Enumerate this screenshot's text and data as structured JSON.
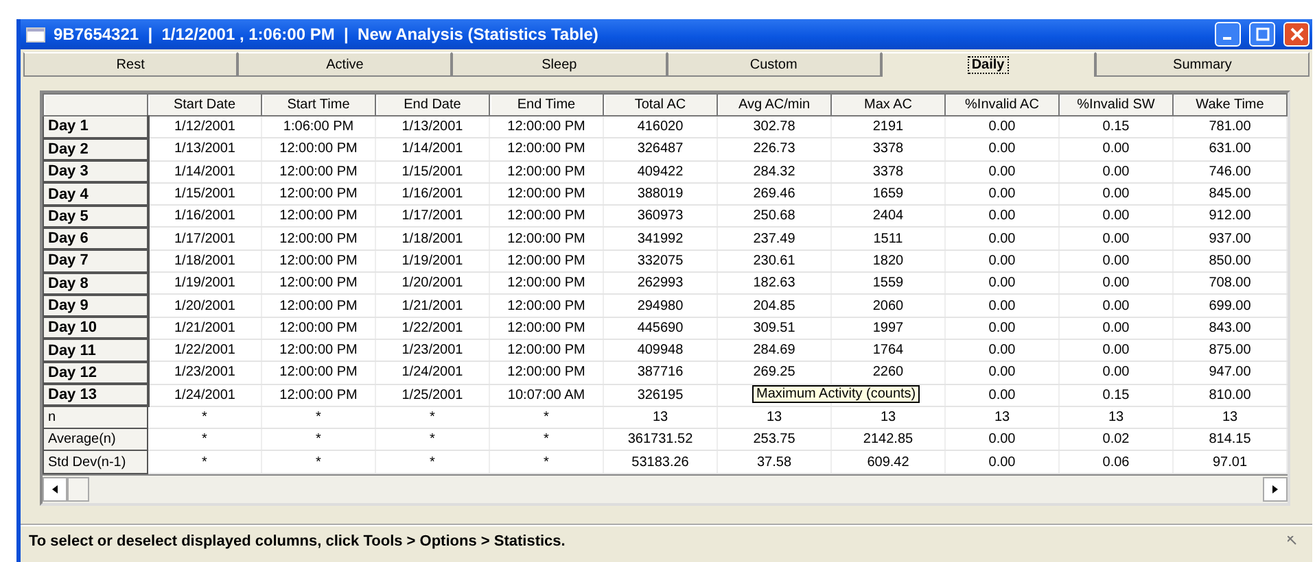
{
  "window": {
    "title": "9B7654321  |  1/12/2001 , 1:06:00 PM  |  New Analysis (Statistics Table)"
  },
  "tabs": [
    {
      "label": "Rest",
      "selected": false
    },
    {
      "label": "Active",
      "selected": false
    },
    {
      "label": "Sleep",
      "selected": false
    },
    {
      "label": "Custom",
      "selected": false
    },
    {
      "label": "Daily",
      "selected": true
    },
    {
      "label": "Summary",
      "selected": false
    }
  ],
  "table": {
    "columns": [
      "Start Date",
      "Start Time",
      "End Date",
      "End Time",
      "Total AC",
      "Avg AC/min",
      "Max AC",
      "%Invalid AC",
      "%Invalid SW",
      "Wake Time"
    ],
    "rows": [
      {
        "kind": "day",
        "label": "Day 1",
        "cells": [
          "1/12/2001",
          "1:06:00 PM",
          "1/13/2001",
          "12:00:00 PM",
          "416020",
          "302.78",
          "2191",
          "0.00",
          "0.15",
          "781.00"
        ]
      },
      {
        "kind": "day",
        "label": "Day 2",
        "cells": [
          "1/13/2001",
          "12:00:00 PM",
          "1/14/2001",
          "12:00:00 PM",
          "326487",
          "226.73",
          "3378",
          "0.00",
          "0.00",
          "631.00"
        ]
      },
      {
        "kind": "day",
        "label": "Day 3",
        "cells": [
          "1/14/2001",
          "12:00:00 PM",
          "1/15/2001",
          "12:00:00 PM",
          "409422",
          "284.32",
          "3378",
          "0.00",
          "0.00",
          "746.00"
        ]
      },
      {
        "kind": "day",
        "label": "Day 4",
        "cells": [
          "1/15/2001",
          "12:00:00 PM",
          "1/16/2001",
          "12:00:00 PM",
          "388019",
          "269.46",
          "1659",
          "0.00",
          "0.00",
          "845.00"
        ]
      },
      {
        "kind": "day",
        "label": "Day 5",
        "cells": [
          "1/16/2001",
          "12:00:00 PM",
          "1/17/2001",
          "12:00:00 PM",
          "360973",
          "250.68",
          "2404",
          "0.00",
          "0.00",
          "912.00"
        ]
      },
      {
        "kind": "day",
        "label": "Day 6",
        "cells": [
          "1/17/2001",
          "12:00:00 PM",
          "1/18/2001",
          "12:00:00 PM",
          "341992",
          "237.49",
          "1511",
          "0.00",
          "0.00",
          "937.00"
        ]
      },
      {
        "kind": "day",
        "label": "Day 7",
        "cells": [
          "1/18/2001",
          "12:00:00 PM",
          "1/19/2001",
          "12:00:00 PM",
          "332075",
          "230.61",
          "1820",
          "0.00",
          "0.00",
          "850.00"
        ]
      },
      {
        "kind": "day",
        "label": "Day 8",
        "cells": [
          "1/19/2001",
          "12:00:00 PM",
          "1/20/2001",
          "12:00:00 PM",
          "262993",
          "182.63",
          "1559",
          "0.00",
          "0.00",
          "708.00"
        ]
      },
      {
        "kind": "day",
        "label": "Day 9",
        "cells": [
          "1/20/2001",
          "12:00:00 PM",
          "1/21/2001",
          "12:00:00 PM",
          "294980",
          "204.85",
          "2060",
          "0.00",
          "0.00",
          "699.00"
        ]
      },
      {
        "kind": "day",
        "label": "Day 10",
        "cells": [
          "1/21/2001",
          "12:00:00 PM",
          "1/22/2001",
          "12:00:00 PM",
          "445690",
          "309.51",
          "1997",
          "0.00",
          "0.00",
          "843.00"
        ]
      },
      {
        "kind": "day",
        "label": "Day 11",
        "cells": [
          "1/22/2001",
          "12:00:00 PM",
          "1/23/2001",
          "12:00:00 PM",
          "409948",
          "284.69",
          "1764",
          "0.00",
          "0.00",
          "875.00"
        ]
      },
      {
        "kind": "day",
        "label": "Day 12",
        "cells": [
          "1/23/2001",
          "12:00:00 PM",
          "1/24/2001",
          "12:00:00 PM",
          "387716",
          "269.25",
          "2260",
          "0.00",
          "0.00",
          "947.00"
        ]
      },
      {
        "kind": "day",
        "label": "Day 13",
        "cells": [
          "1/24/2001",
          "12:00:00 PM",
          "1/25/2001",
          "10:07:00 AM",
          "326195",
          null,
          null,
          "0.00",
          "0.15",
          "810.00"
        ]
      },
      {
        "kind": "summary",
        "label": "n",
        "cells": [
          "*",
          "*",
          "*",
          "*",
          "13",
          "13",
          "13",
          "13",
          "13",
          "13"
        ]
      },
      {
        "kind": "summary",
        "label": "Average(n)",
        "cells": [
          "*",
          "*",
          "*",
          "*",
          "361731.52",
          "253.75",
          "2142.85",
          "0.00",
          "0.02",
          "814.15"
        ]
      },
      {
        "kind": "summary",
        "label": "Std Dev(n-1)",
        "cells": [
          "*",
          "*",
          "*",
          "*",
          "53183.26",
          "37.58",
          "609.42",
          "0.00",
          "0.06",
          "97.01"
        ]
      }
    ]
  },
  "tooltip": {
    "text": "Maximum Activity (counts)"
  },
  "status_bar": {
    "text": "To select or deselect displayed columns, click Tools > Options > Statistics."
  }
}
